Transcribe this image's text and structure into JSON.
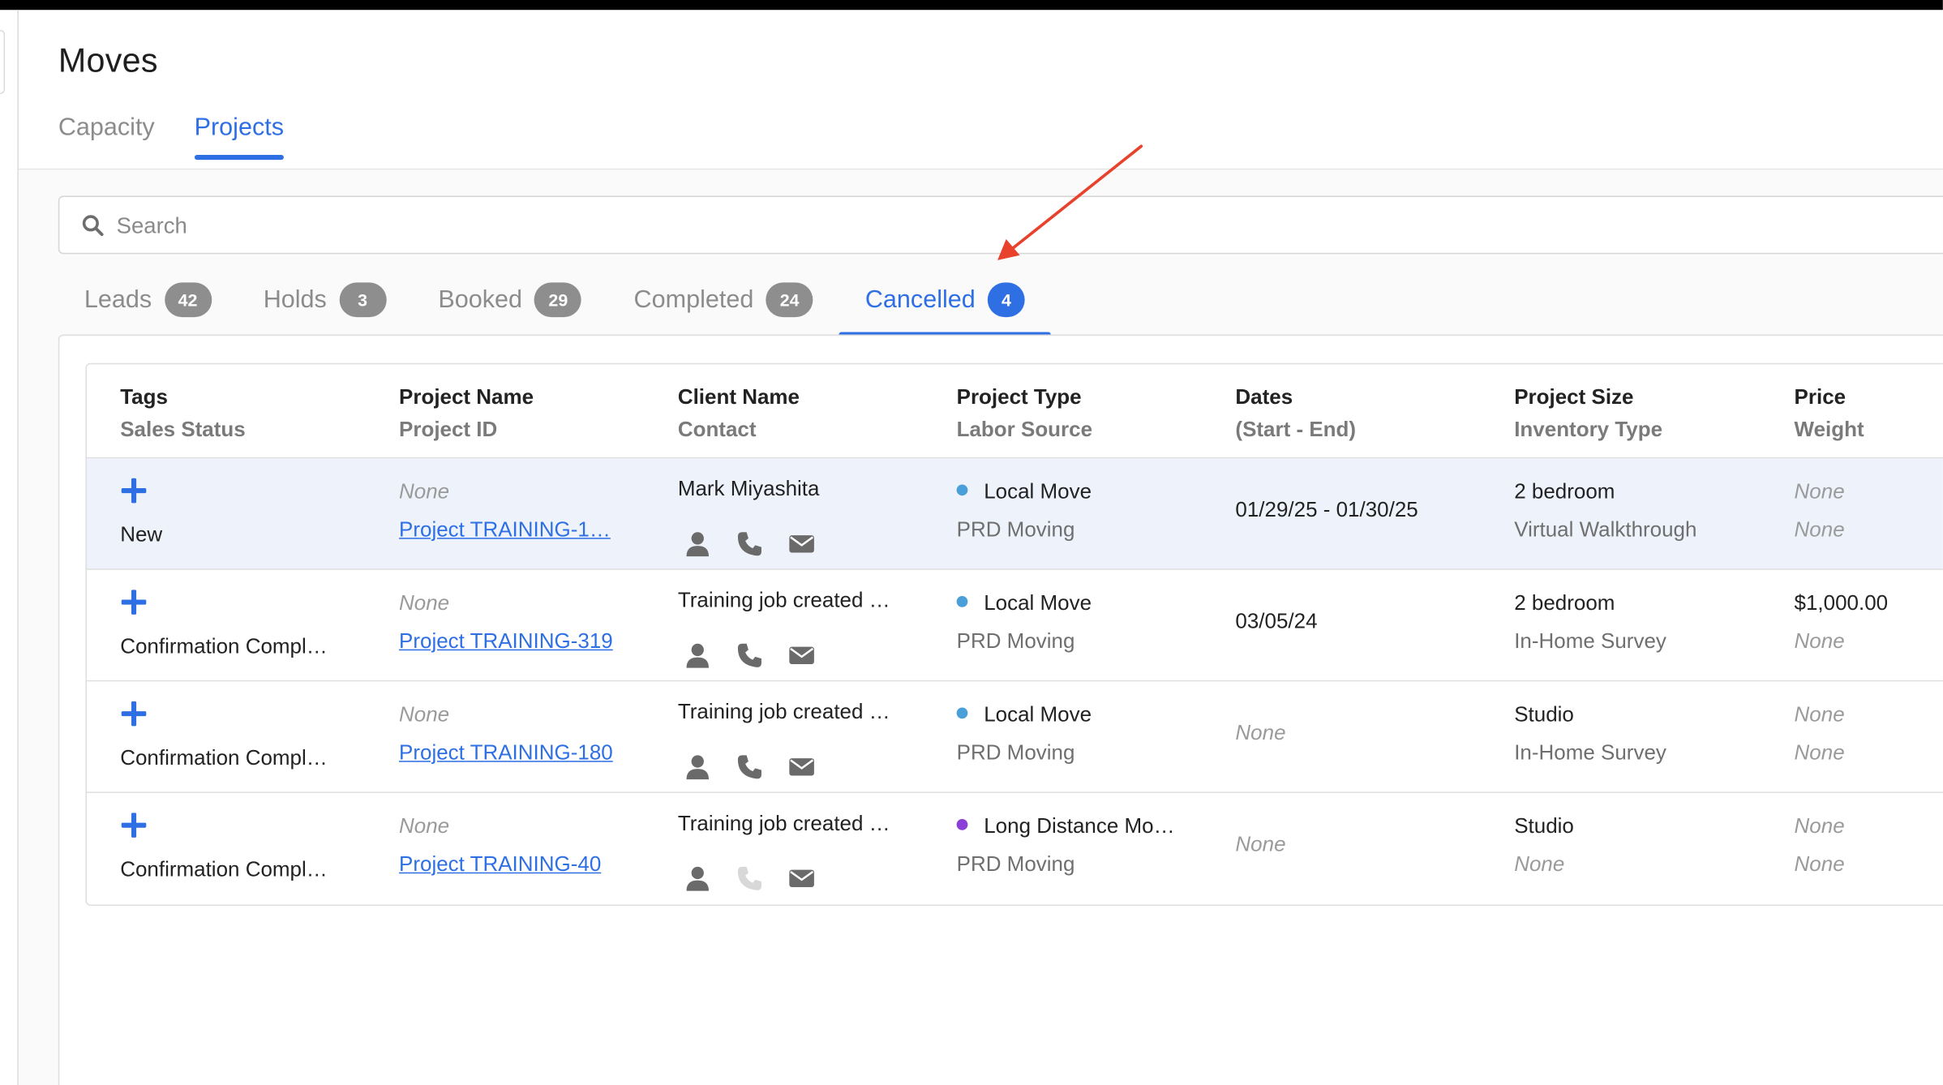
{
  "page": {
    "title": "Moves"
  },
  "main_tabs": [
    {
      "label": "Capacity",
      "active": false
    },
    {
      "label": "Projects",
      "active": true
    }
  ],
  "search": {
    "placeholder": "Search",
    "value": ""
  },
  "status_tabs": [
    {
      "label": "Leads",
      "count": "42",
      "active": false
    },
    {
      "label": "Holds",
      "count": "3",
      "active": false
    },
    {
      "label": "Booked",
      "count": "29",
      "active": false
    },
    {
      "label": "Completed",
      "count": "24",
      "active": false
    },
    {
      "label": "Cancelled",
      "count": "4",
      "active": true
    }
  ],
  "table": {
    "headers": [
      {
        "line1": "Tags",
        "line2": "Sales Status"
      },
      {
        "line1": "Project Name",
        "line2": "Project ID"
      },
      {
        "line1": "Client Name",
        "line2": "Contact"
      },
      {
        "line1": "Project Type",
        "line2": "Labor Source"
      },
      {
        "line1": "Dates",
        "line2": "(Start - End)"
      },
      {
        "line1": "Project Size",
        "line2": "Inventory Type"
      },
      {
        "line1": "Price",
        "line2": "Weight"
      }
    ],
    "rows": [
      {
        "sales_status": "New",
        "project_name": "None",
        "project_id": "Project TRAINING-1…",
        "client_name": "Mark Miyashita",
        "project_type": "Local Move",
        "project_type_color": "#4a9fd8",
        "labor_source": "PRD Moving",
        "dates": "01/29/25 - 01/30/25",
        "project_size": "2 bedroom",
        "inventory_type": "Virtual Walkthrough",
        "price": "None",
        "weight": "None"
      },
      {
        "sales_status": "Confirmation Compl…",
        "project_name": "None",
        "project_id": "Project TRAINING-319",
        "client_name": "Training job created …",
        "project_type": "Local Move",
        "project_type_color": "#4a9fd8",
        "labor_source": "PRD Moving",
        "dates": "03/05/24",
        "project_size": "2 bedroom",
        "inventory_type": "In-Home Survey",
        "price": "$1,000.00",
        "weight": "None"
      },
      {
        "sales_status": "Confirmation Compl…",
        "project_name": "None",
        "project_id": "Project TRAINING-180",
        "client_name": "Training job created …",
        "project_type": "Local Move",
        "project_type_color": "#4a9fd8",
        "labor_source": "PRD Moving",
        "dates": "None",
        "project_size": "Studio",
        "inventory_type": "In-Home Survey",
        "price": "None",
        "weight": "None"
      },
      {
        "sales_status": "Confirmation Compl…",
        "project_name": "None",
        "project_id": "Project TRAINING-40",
        "client_name": "Training job created …",
        "project_type": "Long Distance Mo…",
        "project_type_color": "#8c3fd6",
        "labor_source": "PRD Moving",
        "dates": "None",
        "project_size": "Studio",
        "inventory_type": "None",
        "price": "None",
        "weight": "None"
      }
    ]
  },
  "colors": {
    "accent": "#2f6fe4",
    "annotation_arrow": "#e8412c"
  },
  "icons": [
    "search-icon",
    "add-tag-icon",
    "person-icon",
    "phone-icon",
    "email-icon"
  ]
}
